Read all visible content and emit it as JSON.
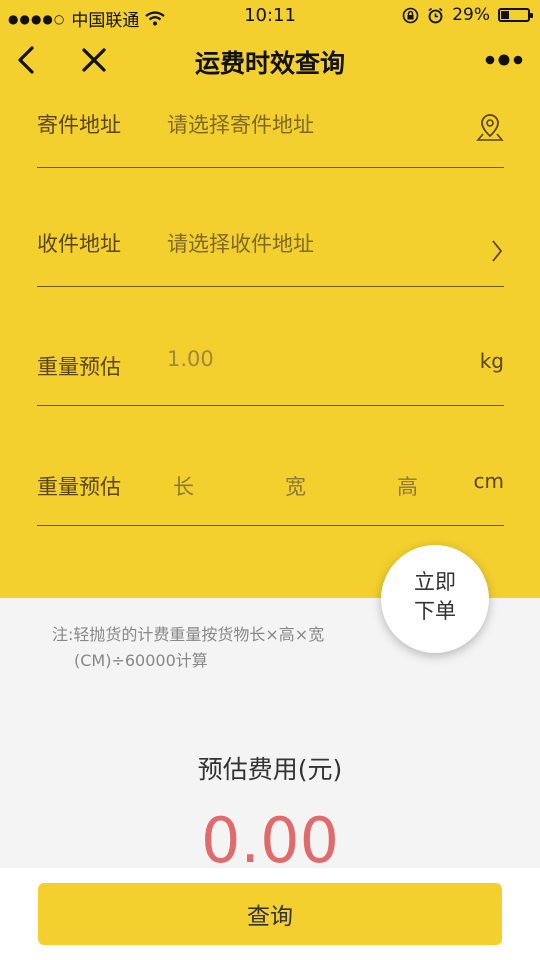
{
  "status_bar": {
    "carrier": "中国联通",
    "time": "10:11",
    "battery": "29%",
    "battery_level": 0.29
  },
  "nav": {
    "title": "运费时效查询"
  },
  "form": {
    "sender": {
      "label": "寄件地址",
      "placeholder": "请选择寄件地址"
    },
    "receiver": {
      "label": "收件地址",
      "placeholder": "请选择收件地址"
    },
    "weight": {
      "label": "重量预估",
      "value": "1.00",
      "unit": "kg"
    },
    "dimensions": {
      "label": "重量预估",
      "length": "长",
      "width": "宽",
      "height": "高",
      "unit": "cm"
    }
  },
  "order_button": {
    "line1": "立即",
    "line2": "下单"
  },
  "note": {
    "line1": "注:轻抛货的计费重量按货物长×高×宽",
    "line2": "(CM)÷60000计算"
  },
  "fee": {
    "label": "预估费用(元)",
    "value": "0.00"
  },
  "query_button": {
    "label": "查询"
  },
  "colors": {
    "brand": "#f3d02e",
    "fee": "#e06a6c"
  }
}
